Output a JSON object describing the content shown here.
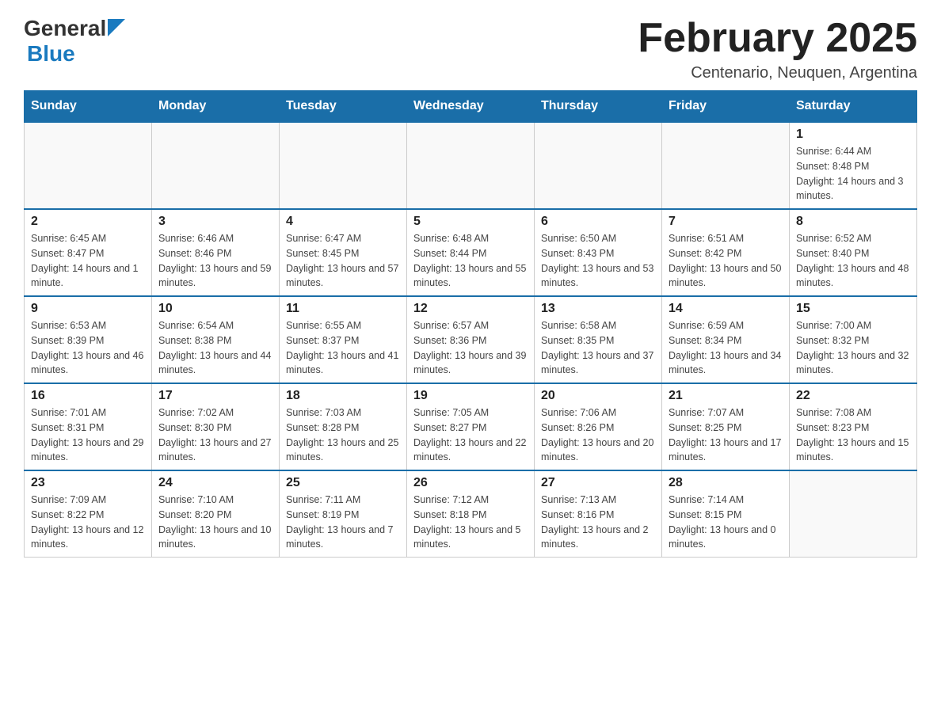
{
  "header": {
    "logo_general": "General",
    "logo_blue": "Blue",
    "title": "February 2025",
    "subtitle": "Centenario, Neuquen, Argentina"
  },
  "weekdays": [
    "Sunday",
    "Monday",
    "Tuesday",
    "Wednesday",
    "Thursday",
    "Friday",
    "Saturday"
  ],
  "weeks": [
    [
      {
        "day": "",
        "info": ""
      },
      {
        "day": "",
        "info": ""
      },
      {
        "day": "",
        "info": ""
      },
      {
        "day": "",
        "info": ""
      },
      {
        "day": "",
        "info": ""
      },
      {
        "day": "",
        "info": ""
      },
      {
        "day": "1",
        "info": "Sunrise: 6:44 AM\nSunset: 8:48 PM\nDaylight: 14 hours and 3 minutes."
      }
    ],
    [
      {
        "day": "2",
        "info": "Sunrise: 6:45 AM\nSunset: 8:47 PM\nDaylight: 14 hours and 1 minute."
      },
      {
        "day": "3",
        "info": "Sunrise: 6:46 AM\nSunset: 8:46 PM\nDaylight: 13 hours and 59 minutes."
      },
      {
        "day": "4",
        "info": "Sunrise: 6:47 AM\nSunset: 8:45 PM\nDaylight: 13 hours and 57 minutes."
      },
      {
        "day": "5",
        "info": "Sunrise: 6:48 AM\nSunset: 8:44 PM\nDaylight: 13 hours and 55 minutes."
      },
      {
        "day": "6",
        "info": "Sunrise: 6:50 AM\nSunset: 8:43 PM\nDaylight: 13 hours and 53 minutes."
      },
      {
        "day": "7",
        "info": "Sunrise: 6:51 AM\nSunset: 8:42 PM\nDaylight: 13 hours and 50 minutes."
      },
      {
        "day": "8",
        "info": "Sunrise: 6:52 AM\nSunset: 8:40 PM\nDaylight: 13 hours and 48 minutes."
      }
    ],
    [
      {
        "day": "9",
        "info": "Sunrise: 6:53 AM\nSunset: 8:39 PM\nDaylight: 13 hours and 46 minutes."
      },
      {
        "day": "10",
        "info": "Sunrise: 6:54 AM\nSunset: 8:38 PM\nDaylight: 13 hours and 44 minutes."
      },
      {
        "day": "11",
        "info": "Sunrise: 6:55 AM\nSunset: 8:37 PM\nDaylight: 13 hours and 41 minutes."
      },
      {
        "day": "12",
        "info": "Sunrise: 6:57 AM\nSunset: 8:36 PM\nDaylight: 13 hours and 39 minutes."
      },
      {
        "day": "13",
        "info": "Sunrise: 6:58 AM\nSunset: 8:35 PM\nDaylight: 13 hours and 37 minutes."
      },
      {
        "day": "14",
        "info": "Sunrise: 6:59 AM\nSunset: 8:34 PM\nDaylight: 13 hours and 34 minutes."
      },
      {
        "day": "15",
        "info": "Sunrise: 7:00 AM\nSunset: 8:32 PM\nDaylight: 13 hours and 32 minutes."
      }
    ],
    [
      {
        "day": "16",
        "info": "Sunrise: 7:01 AM\nSunset: 8:31 PM\nDaylight: 13 hours and 29 minutes."
      },
      {
        "day": "17",
        "info": "Sunrise: 7:02 AM\nSunset: 8:30 PM\nDaylight: 13 hours and 27 minutes."
      },
      {
        "day": "18",
        "info": "Sunrise: 7:03 AM\nSunset: 8:28 PM\nDaylight: 13 hours and 25 minutes."
      },
      {
        "day": "19",
        "info": "Sunrise: 7:05 AM\nSunset: 8:27 PM\nDaylight: 13 hours and 22 minutes."
      },
      {
        "day": "20",
        "info": "Sunrise: 7:06 AM\nSunset: 8:26 PM\nDaylight: 13 hours and 20 minutes."
      },
      {
        "day": "21",
        "info": "Sunrise: 7:07 AM\nSunset: 8:25 PM\nDaylight: 13 hours and 17 minutes."
      },
      {
        "day": "22",
        "info": "Sunrise: 7:08 AM\nSunset: 8:23 PM\nDaylight: 13 hours and 15 minutes."
      }
    ],
    [
      {
        "day": "23",
        "info": "Sunrise: 7:09 AM\nSunset: 8:22 PM\nDaylight: 13 hours and 12 minutes."
      },
      {
        "day": "24",
        "info": "Sunrise: 7:10 AM\nSunset: 8:20 PM\nDaylight: 13 hours and 10 minutes."
      },
      {
        "day": "25",
        "info": "Sunrise: 7:11 AM\nSunset: 8:19 PM\nDaylight: 13 hours and 7 minutes."
      },
      {
        "day": "26",
        "info": "Sunrise: 7:12 AM\nSunset: 8:18 PM\nDaylight: 13 hours and 5 minutes."
      },
      {
        "day": "27",
        "info": "Sunrise: 7:13 AM\nSunset: 8:16 PM\nDaylight: 13 hours and 2 minutes."
      },
      {
        "day": "28",
        "info": "Sunrise: 7:14 AM\nSunset: 8:15 PM\nDaylight: 13 hours and 0 minutes."
      },
      {
        "day": "",
        "info": ""
      }
    ]
  ]
}
